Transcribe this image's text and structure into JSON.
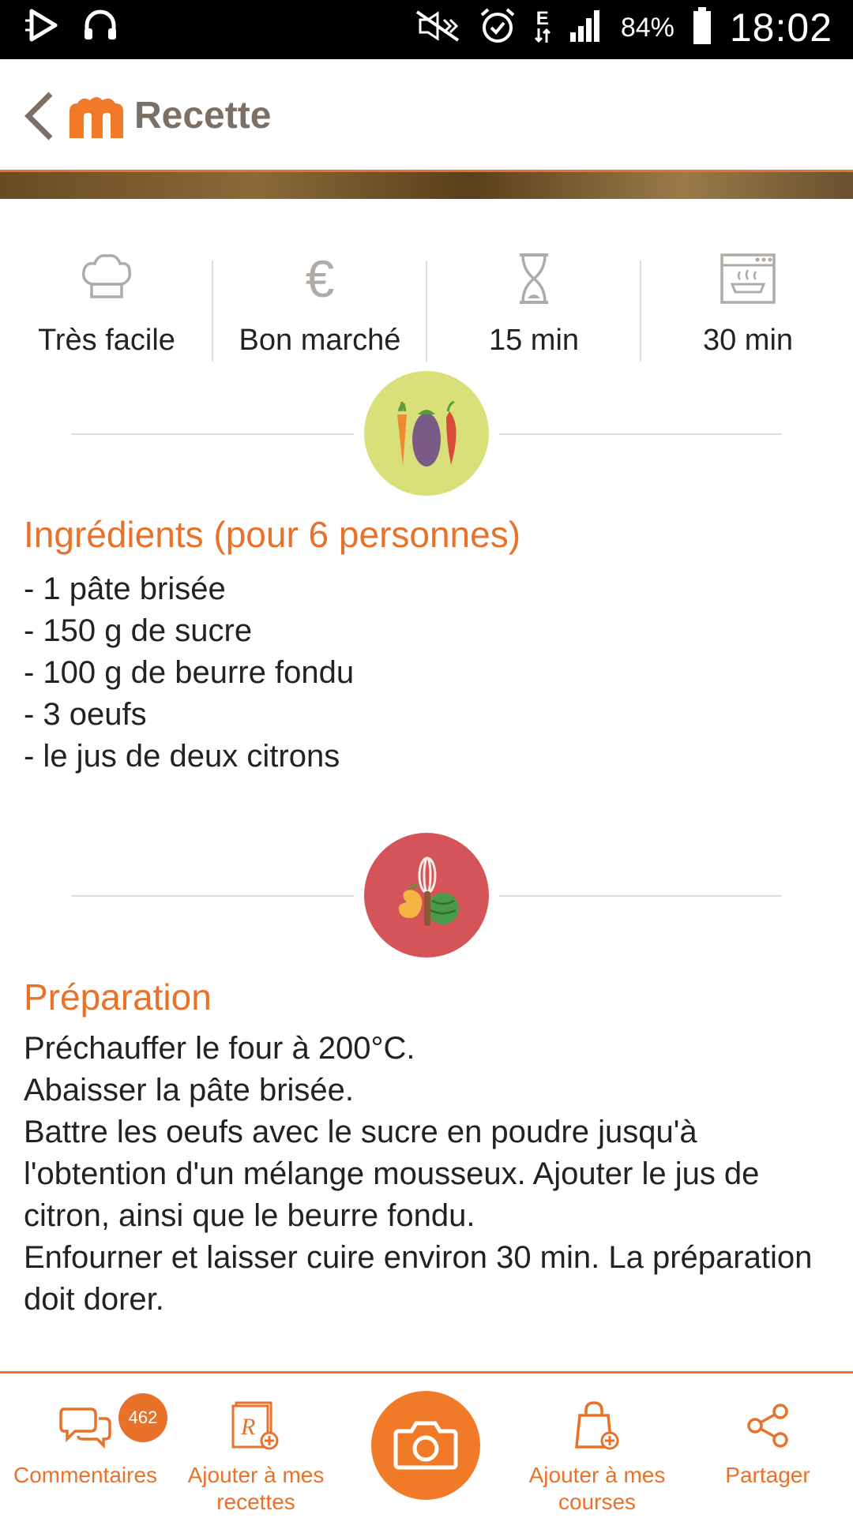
{
  "status_bar": {
    "battery_percent": "84%",
    "time": "18:02",
    "network": "E"
  },
  "header": {
    "title": "Recette"
  },
  "infos": [
    {
      "label": "Très facile",
      "icon": "chef-hat-icon"
    },
    {
      "label": "Bon marché",
      "icon": "euro-icon"
    },
    {
      "label": "15 min",
      "icon": "hourglass-icon"
    },
    {
      "label": "30 min",
      "icon": "oven-icon"
    }
  ],
  "ingredients": {
    "title": "Ingrédients (pour 6 personnes)",
    "items": [
      "- 1 pâte brisée",
      "- 150 g de sucre",
      "- 100 g de beurre fondu",
      "- 3 oeufs",
      "- le jus de deux citrons"
    ]
  },
  "preparation": {
    "title": "Préparation",
    "lines": [
      "Préchauffer le four à 200°C.",
      "Abaisser la pâte brisée.",
      "Battre les oeufs avec le sucre en poudre jusqu'à l'obtention d'un mélange mousseux. Ajouter le jus de citron, ainsi que le beurre fondu.",
      "Enfourner et laisser cuire environ 30 min. La préparation doit dorer."
    ]
  },
  "bottom_bar": {
    "comments_label": "Commentaires",
    "comments_count": "462",
    "add_recipes_line1": "Ajouter à mes",
    "add_recipes_line2": "recettes",
    "add_courses_line1": "Ajouter à mes",
    "add_courses_line2": "courses",
    "share_label": "Partager"
  },
  "colors": {
    "accent": "#e8722a",
    "ingredients_badge": "#d9e07a",
    "preparation_badge": "#d4545a"
  }
}
